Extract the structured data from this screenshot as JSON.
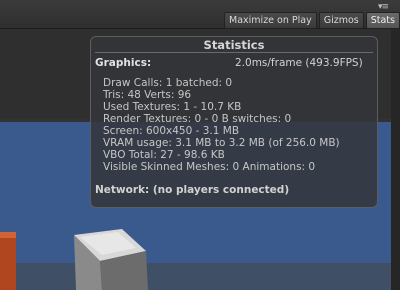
{
  "toolbar": {
    "menu_icon": "menu-icon",
    "buttons": [
      "Maximize on Play",
      "Gizmos",
      "Stats"
    ]
  },
  "stats": {
    "title": "Statistics",
    "graphics_label": "Graphics:",
    "graphics_value": "2.0ms/frame (493.9FPS)",
    "lines": [
      "Draw Calls: 1   batched: 0",
      "Tris: 48   Verts: 96",
      "Used Textures: 1 - 10.7 KB",
      "Render Textures: 0 - 0 B   switches: 0",
      "Screen: 600x450 - 3.1 MB",
      "VRAM usage: 3.1 MB to 3.2 MB (of 256.0 MB)",
      "VBO Total: 27 - 98.6 KB",
      "Visible Skinned Meshes: 0     Animations: 0"
    ],
    "network": "Network: (no players connected)"
  },
  "colors": {
    "panel_bg": "#34363a",
    "scene_blue": "#3a5a8e",
    "cube_red": "#b0461f"
  }
}
